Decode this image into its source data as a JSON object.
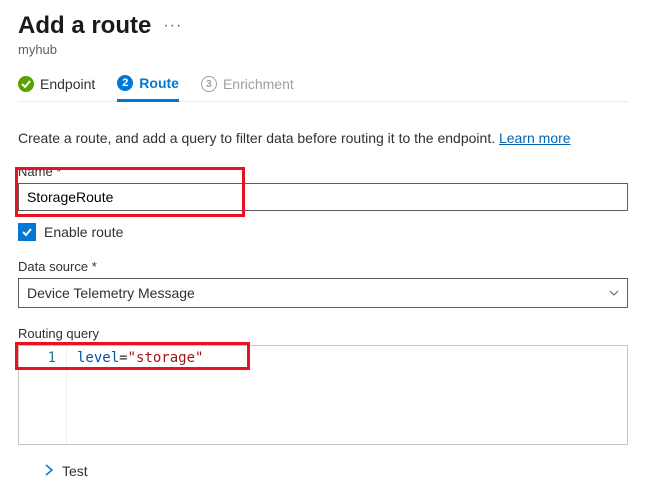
{
  "header": {
    "title": "Add a route",
    "more": "···",
    "subtitle": "myhub"
  },
  "steps": {
    "endpoint": {
      "label": "Endpoint",
      "check": "✓"
    },
    "route": {
      "label": "Route",
      "num": "2"
    },
    "enrich": {
      "label": "Enrichment",
      "num": "3"
    }
  },
  "desc": {
    "text": "Create a route, and add a query to filter data before routing it to the endpoint.",
    "learn": "Learn more"
  },
  "form": {
    "name_label": "Name",
    "name_value": "StorageRoute",
    "enable_label": "Enable route",
    "source_label": "Data source",
    "source_value": "Device Telemetry Message",
    "query_label": "Routing query",
    "query_line_no": "1",
    "query_attr": "level",
    "query_op": "=",
    "query_str": "\"storage\"",
    "test_label": "Test"
  }
}
